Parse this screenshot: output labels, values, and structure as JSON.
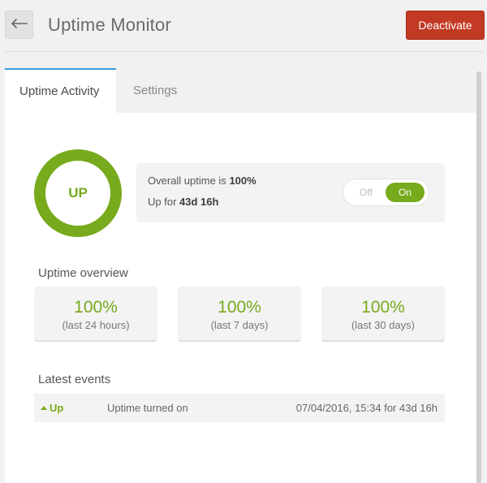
{
  "header": {
    "title": "Uptime Monitor",
    "back_icon": "arrow-left-icon",
    "deactivate_label": "Deactivate",
    "deactivate_color": "#c23a23"
  },
  "tabs": [
    {
      "label": "Uptime Activity",
      "active": true
    },
    {
      "label": "Settings",
      "active": false
    }
  ],
  "status": {
    "state": "UP",
    "overall_prefix": "Overall uptime is",
    "overall_value": "100%",
    "up_prefix": "Up for",
    "up_value": "43d 16h",
    "accent_color": "#77aa1c"
  },
  "toggle": {
    "off_label": "Off",
    "on_label": "On",
    "selected": "On"
  },
  "overview": {
    "heading": "Uptime overview",
    "cards": [
      {
        "value": "100%",
        "period": "(last 24 hours)"
      },
      {
        "value": "100%",
        "period": "(last 7 days)"
      },
      {
        "value": "100%",
        "period": "(last 30 days)"
      }
    ]
  },
  "events": {
    "heading": "Latest events",
    "items": [
      {
        "status": "Up",
        "description": "Uptime turned on",
        "time": "07/04/2016, 15:34 for 43d 16h"
      }
    ]
  }
}
